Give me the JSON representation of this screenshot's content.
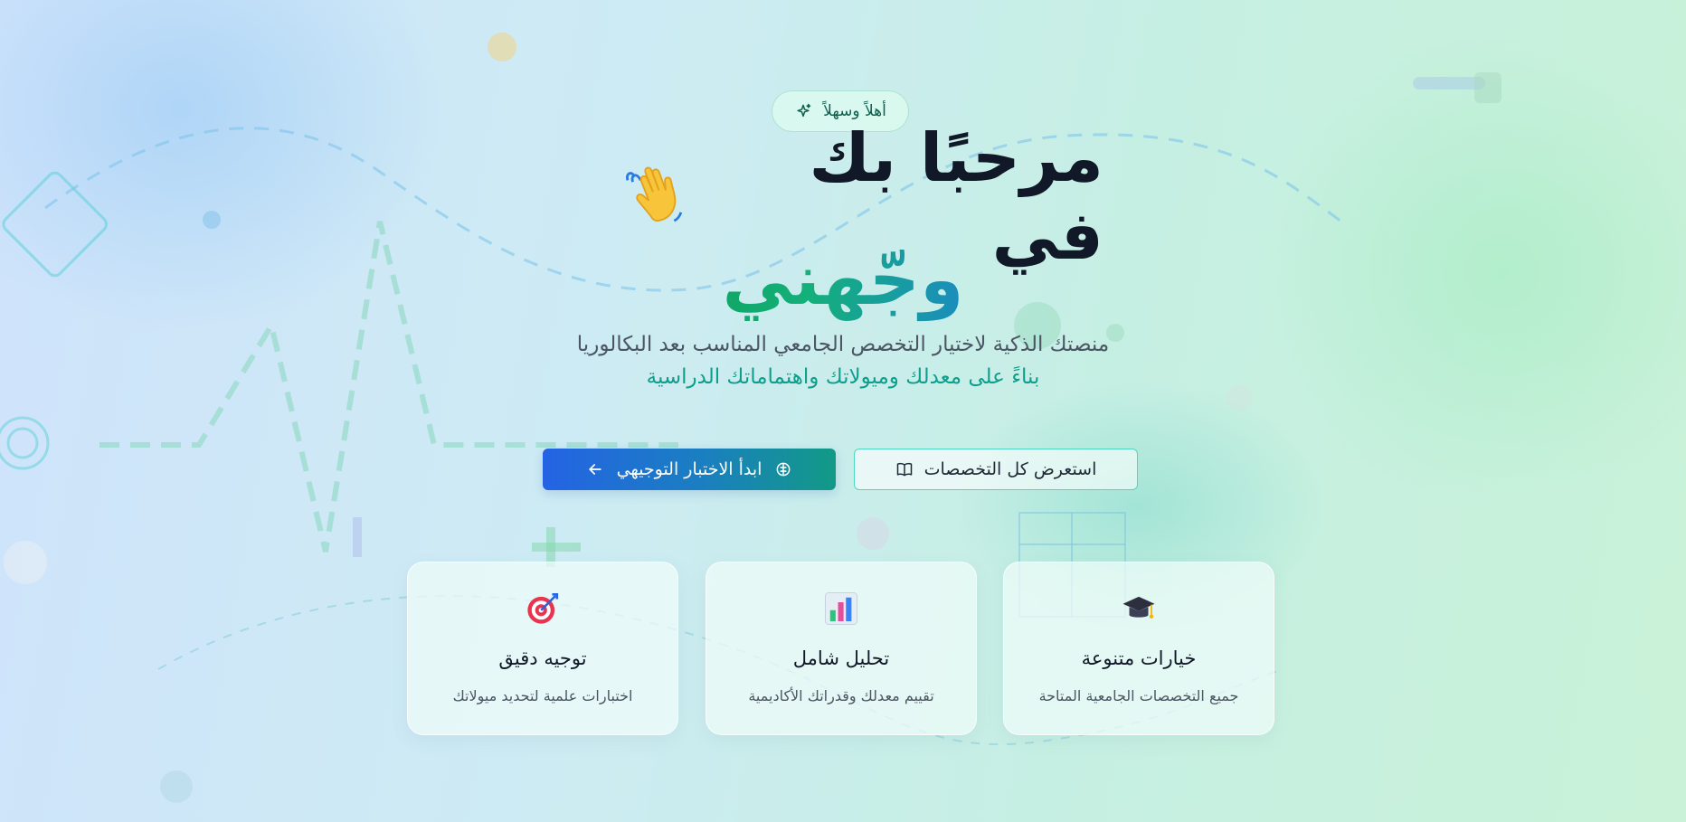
{
  "badge": {
    "label": "أهلاً وسهلاً",
    "icon": "sparkles-icon"
  },
  "hero": {
    "title_line1": "مرحبًا بك في",
    "title_emoji": "waving-hand-icon",
    "brand": "وجّهني",
    "subtitle_line1": "منصتك الذكية لاختيار التخصص الجامعي المناسب بعد البكالوريا",
    "subtitle_line2": "بناءً على معدلك وميولاتك واهتماماتك الدراسية"
  },
  "actions": {
    "primary_label": "ابدأ الاختبار التوجيهي",
    "primary_icons": [
      "brain-icon",
      "arrow-left-icon"
    ],
    "secondary_label": "استعرض كل التخصصات",
    "secondary_icon": "book-open-icon"
  },
  "features": [
    {
      "title": "خيارات متنوعة",
      "description": "جميع التخصصات الجامعية المتاحة",
      "icon": "graduation-cap-icon"
    },
    {
      "title": "تحليل شامل",
      "description": "تقييم معدلك وقدراتك الأكاديمية",
      "icon": "bar-chart-icon"
    },
    {
      "title": "توجيه دقيق",
      "description": "اختبارات علمية لتحديد ميولاتك",
      "icon": "target-icon"
    }
  ],
  "colors": {
    "primary_gradient_start": "#2463e4",
    "primary_gradient_end": "#129a86",
    "brand_green": "#0ea05a",
    "brand_blue": "#1e7fd8",
    "accent_teal": "#0e9f8c"
  }
}
